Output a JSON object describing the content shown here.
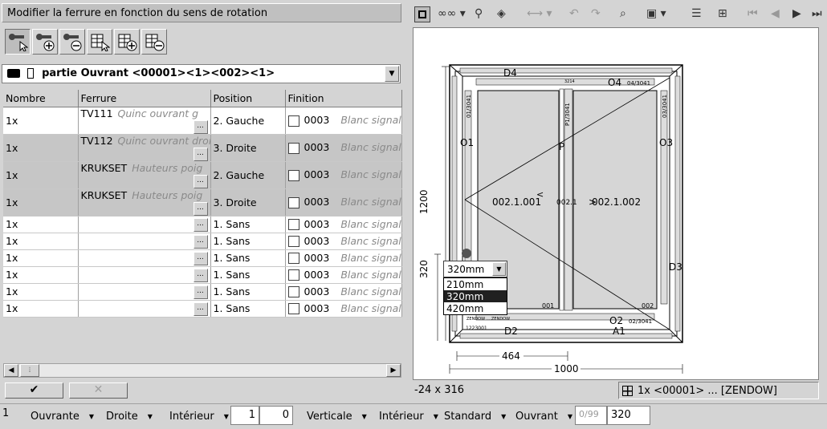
{
  "title": "Modifier la ferrure en fonction du sens de rotation",
  "toolbar": {
    "icons": [
      "select-hardware-icon",
      "add-hardware-icon",
      "remove-hardware-icon",
      "select-group-icon",
      "add-group-icon",
      "remove-group-icon"
    ]
  },
  "part_selector": {
    "value": "partie Ouvrant <00001><1><002><1>"
  },
  "table": {
    "headers": [
      "Nombre",
      "Ferrure",
      "Position",
      "Finition"
    ],
    "rows": [
      {
        "nombre": "1x",
        "ferrure": "TV111",
        "hint": "Quinc ouvrant g",
        "position": "2. Gauche",
        "code": "0003",
        "finition": "Blanc signal"
      },
      {
        "nombre": "1x",
        "ferrure": "TV112",
        "hint": "Quinc ouvrant droi",
        "position": "3. Droite",
        "code": "0003",
        "finition": "Blanc signal"
      },
      {
        "nombre": "1x",
        "ferrure": "KRUKSET",
        "hint": "Hauteurs poig",
        "position": "2. Gauche",
        "code": "0003",
        "finition": "Blanc signal"
      },
      {
        "nombre": "1x",
        "ferrure": "KRUKSET",
        "hint": "Hauteurs poig",
        "position": "3. Droite",
        "code": "0003",
        "finition": "Blanc signal"
      },
      {
        "nombre": "1x",
        "ferrure": "",
        "hint": "",
        "position": "1. Sans",
        "code": "0003",
        "finition": "Blanc signal"
      },
      {
        "nombre": "1x",
        "ferrure": "",
        "hint": "",
        "position": "1. Sans",
        "code": "0003",
        "finition": "Blanc signal"
      },
      {
        "nombre": "1x",
        "ferrure": "",
        "hint": "",
        "position": "1. Sans",
        "code": "0003",
        "finition": "Blanc signal"
      },
      {
        "nombre": "1x",
        "ferrure": "",
        "hint": "",
        "position": "1. Sans",
        "code": "0003",
        "finition": "Blanc signal"
      },
      {
        "nombre": "1x",
        "ferrure": "",
        "hint": "",
        "position": "1. Sans",
        "code": "0003",
        "finition": "Blanc signal"
      },
      {
        "nombre": "1x",
        "ferrure": "",
        "hint": "",
        "position": "1. Sans",
        "code": "0003",
        "finition": "Blanc signal"
      }
    ]
  },
  "buttons": {
    "ok": "✔",
    "cancel": "✕"
  },
  "drawing": {
    "labels": {
      "d4": "D4",
      "o4": "O4",
      "o4_code": "04/3041",
      "o1": "O1",
      "o3": "O3",
      "p": "P",
      "d3": "D3",
      "d2": "D2",
      "a1": "A1",
      "o2": "O2",
      "o2_code": "02/3041",
      "sash_left": "002.1.001",
      "sash_right": "002.1.002",
      "mullion": "002.1",
      "code_001": "001",
      "code_002": "002",
      "code_tl": "01/3041",
      "code_tr": "03/3041",
      "code_p": "P1/3041",
      "code_small": "3214",
      "code_bl": "1223001",
      "code_brand": "ZENDOW ....ZENDOW"
    },
    "dims": {
      "height": "1200",
      "width": "1000",
      "sash_width": "464",
      "handle_height": "320"
    }
  },
  "handle_height_dropdown": {
    "selected": "320mm",
    "options": [
      "210mm",
      "320mm",
      "420mm"
    ],
    "highlighted": "320mm"
  },
  "status": {
    "coords": "-24 x 316",
    "element": "1x <00001> ... [ZENDOW]"
  },
  "bottom_bar": {
    "index": "1",
    "ouvrante": "Ouvrante",
    "droite": "Droite",
    "interieur": "Intérieur",
    "field1": "1",
    "field2": "0",
    "verticale": "Verticale",
    "interieur2": "Intérieur",
    "standard": "Standard",
    "ouvrant": "Ouvrant",
    "count": "0/99",
    "value": "320"
  }
}
